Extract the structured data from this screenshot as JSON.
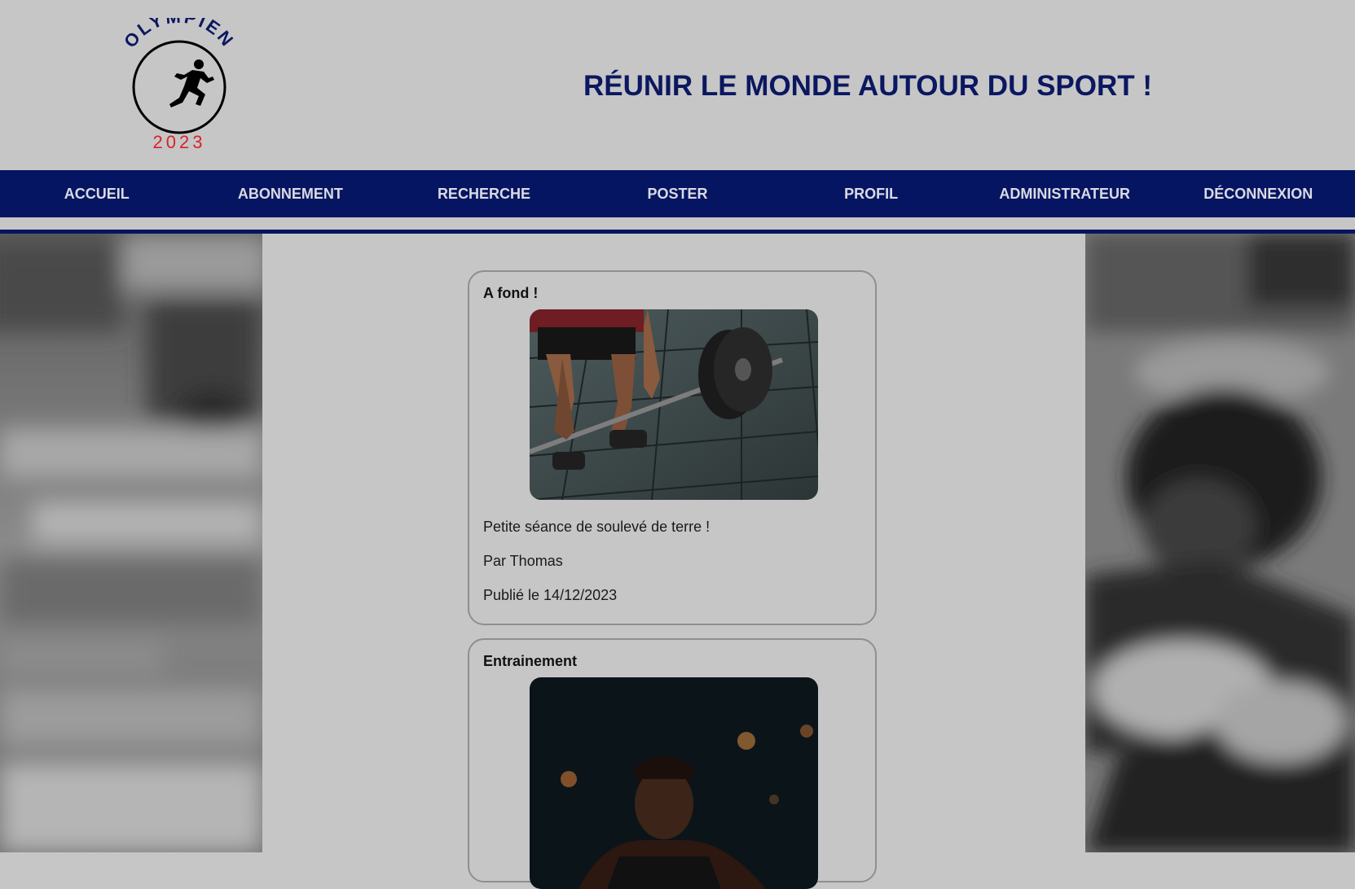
{
  "header": {
    "logo": {
      "arc_text": "OLYMPIEN",
      "year": "2023",
      "icon": "runner-icon"
    },
    "tagline": "RÉUNIR LE MONDE AUTOUR DU SPORT !"
  },
  "nav": {
    "items": [
      {
        "label": "ACCUEIL"
      },
      {
        "label": "ABONNEMENT"
      },
      {
        "label": "RECHERCHE"
      },
      {
        "label": "POSTER"
      },
      {
        "label": "PROFIL"
      },
      {
        "label": "ADMINISTRATEUR"
      },
      {
        "label": "DÉCONNEXION"
      }
    ]
  },
  "posts": [
    {
      "title": "A fond !",
      "image": "deadlift-photo",
      "description": "Petite séance de soulevé de terre !",
      "author": "Par Thomas",
      "date": "Publié le 14/12/2023"
    },
    {
      "title": "Entrainement",
      "image": "athlete-portrait-photo"
    }
  ],
  "colors": {
    "navy": "#061561",
    "tagline": "#0b1760",
    "logo_year": "#d8232a",
    "page_bg": "#c6c6c6"
  }
}
